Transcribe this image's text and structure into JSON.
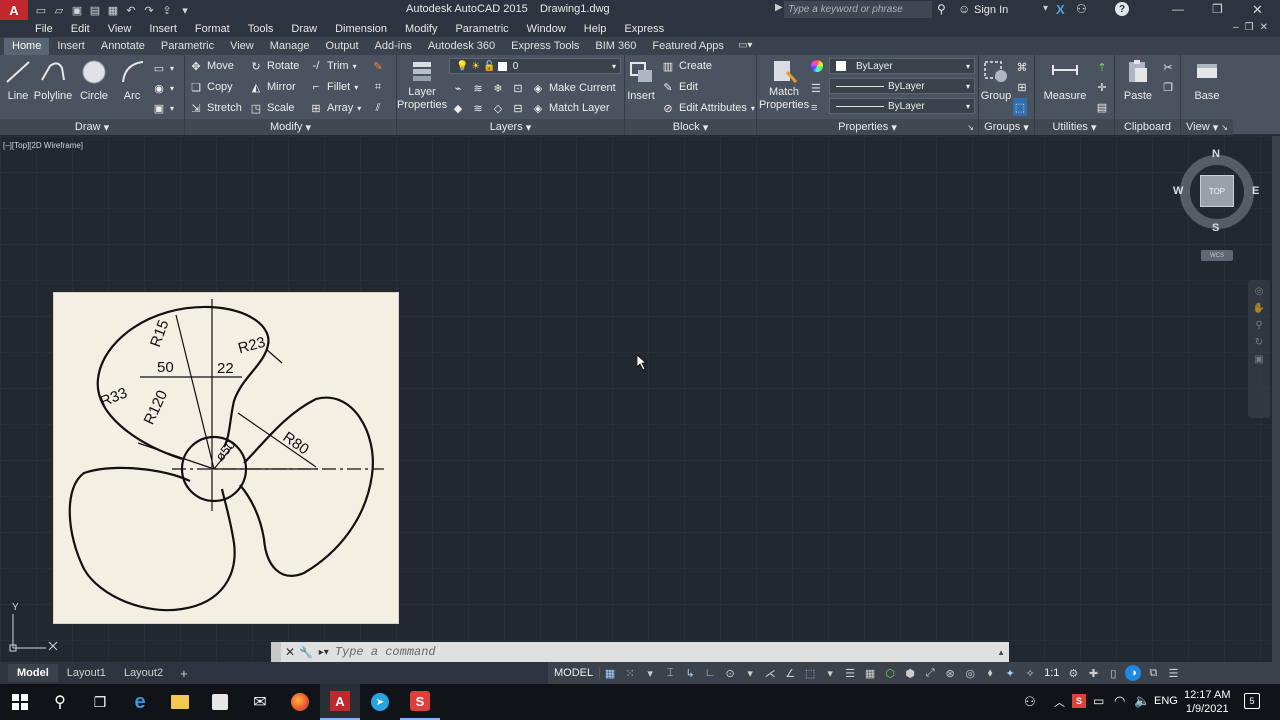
{
  "window": {
    "app_title": "Autodesk AutoCAD 2015",
    "file_title": "Drawing1.dwg",
    "search_placeholder": "Type a keyword or phrase",
    "sign_in": "Sign In"
  },
  "menu": [
    "File",
    "Edit",
    "View",
    "Insert",
    "Format",
    "Tools",
    "Draw",
    "Dimension",
    "Modify",
    "Parametric",
    "Window",
    "Help",
    "Express"
  ],
  "ribbon_tabs": [
    "Home",
    "Insert",
    "Annotate",
    "Parametric",
    "View",
    "Manage",
    "Output",
    "Add-ins",
    "Autodesk 360",
    "Express Tools",
    "BIM 360",
    "Featured Apps"
  ],
  "draw_panel": {
    "title": "Draw",
    "tools": [
      "Line",
      "Polyline",
      "Circle",
      "Arc"
    ]
  },
  "modify_panel": {
    "title": "Modify",
    "tools": [
      "Move",
      "Rotate",
      "Trim",
      "Copy",
      "Mirror",
      "Fillet",
      "Stretch",
      "Scale",
      "Array"
    ]
  },
  "layers_panel": {
    "title": "Layers",
    "big_tool": "Layer Properties",
    "current_layer": "0",
    "tools": [
      "Make Current",
      "Match Layer"
    ]
  },
  "block_panel": {
    "title": "Block",
    "big_tool": "Insert",
    "tools": [
      "Create",
      "Edit",
      "Edit Attributes"
    ]
  },
  "properties_panel": {
    "title": "Properties",
    "big_tool": "Match Properties",
    "color": "ByLayer",
    "linetype": "ByLayer",
    "lineweight": "ByLayer"
  },
  "groups_panel": {
    "title": "Groups",
    "big_tool": "Group"
  },
  "utilities_panel": {
    "title": "Utilities",
    "big_tool": "Measure"
  },
  "clipboard_panel": {
    "title": "Clipboard",
    "big_tool": "Paste"
  },
  "view_panel": {
    "title": "View",
    "big_tool": "Base"
  },
  "viewport": {
    "label": "[–][Top][2D Wireframe]",
    "viewcube": {
      "north": "N",
      "south": "S",
      "east": "E",
      "west": "W",
      "top": "TOP",
      "wcs": "WCS"
    },
    "ucs_y": "Y"
  },
  "drawing": {
    "dimensions": [
      "R15",
      "R23",
      "50",
      "22",
      "R33",
      "R120",
      "ø50",
      "R80"
    ]
  },
  "command": {
    "placeholder": "Type  a  command"
  },
  "layout_tabs": [
    "Model",
    "Layout1",
    "Layout2"
  ],
  "status": {
    "model": "MODEL",
    "scale": "1:1"
  },
  "taskbar": {
    "time": "12:17 AM",
    "date": "1/9/2021",
    "language": "ENG",
    "notifications": "5"
  },
  "colors": {
    "canvas": "#212830",
    "ribbon": "#4a535f",
    "accent": "#1e88e5",
    "paper": "#f3efe3"
  }
}
